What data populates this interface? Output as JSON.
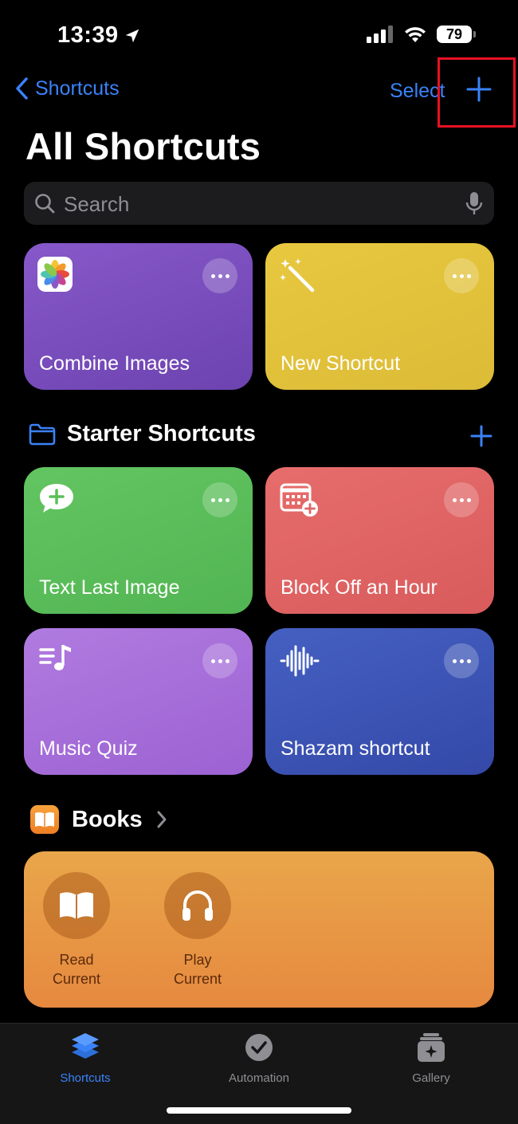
{
  "status": {
    "time": "13:39",
    "battery": "79"
  },
  "nav": {
    "back_label": "Shortcuts",
    "select_label": "Select"
  },
  "page_title": "All Shortcuts",
  "search": {
    "placeholder": "Search"
  },
  "top_tiles": [
    {
      "label": "Combine Images",
      "color": "#7a4fbf",
      "icon": "photos-icon"
    },
    {
      "label": "New Shortcut",
      "color": "#e3c33c",
      "icon": "magic-wand-icon"
    }
  ],
  "starter_section": {
    "title": "Starter Shortcuts"
  },
  "starter_tiles": [
    {
      "label": "Text Last Image",
      "color": "#5cbf5a",
      "icon": "message-plus-icon"
    },
    {
      "label": "Block Off an Hour",
      "color": "#e06566",
      "icon": "calendar-plus-icon"
    },
    {
      "label": "Music Quiz",
      "color": "#a972d9",
      "icon": "music-list-icon"
    },
    {
      "label": "Shazam shortcut",
      "color": "#3b55b5",
      "icon": "waveform-icon"
    }
  ],
  "books_section": {
    "title": "Books",
    "actions": [
      {
        "line1": "Read",
        "line2": "Current"
      },
      {
        "line1": "Play",
        "line2": "Current"
      }
    ]
  },
  "tabbar": {
    "items": [
      {
        "label": "Shortcuts",
        "active": true
      },
      {
        "label": "Automation",
        "active": false
      },
      {
        "label": "Gallery",
        "active": false
      }
    ]
  },
  "colors": {
    "accent": "#3a82f7",
    "highlight": "#e81123"
  }
}
